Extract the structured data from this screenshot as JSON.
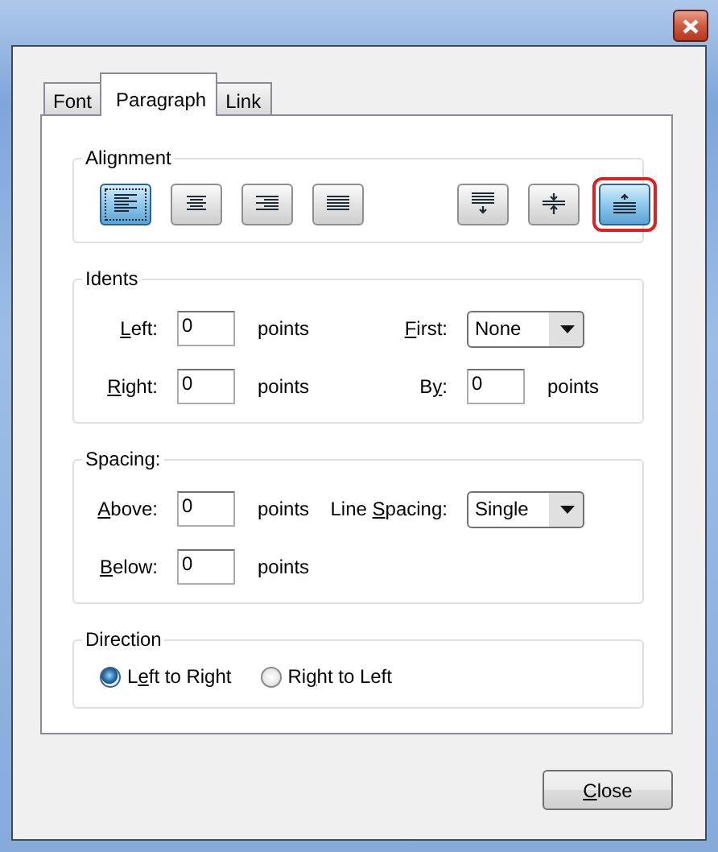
{
  "tabs": [
    {
      "label": "Font",
      "selected": false
    },
    {
      "label": "Paragraph",
      "selected": true
    },
    {
      "label": "Link",
      "selected": false
    }
  ],
  "alignment": {
    "title": "Alignment",
    "horizontal": [
      {
        "kind": "left",
        "selected": true,
        "focused": true,
        "outlined": false
      },
      {
        "kind": "center",
        "selected": false,
        "focused": false,
        "outlined": false
      },
      {
        "kind": "right",
        "selected": false,
        "focused": false,
        "outlined": false
      },
      {
        "kind": "justify",
        "selected": false,
        "focused": false,
        "outlined": false
      }
    ],
    "vertical": [
      {
        "kind": "top",
        "selected": false,
        "focused": false,
        "outlined": false
      },
      {
        "kind": "middle",
        "selected": false,
        "focused": false,
        "outlined": false
      },
      {
        "kind": "bottom",
        "selected": true,
        "focused": false,
        "outlined": true
      }
    ]
  },
  "indents": {
    "title": "Idents",
    "rows": [
      [
        {
          "kind": "number",
          "label": {
            "key": "L",
            "post": "eft:"
          },
          "value": "0",
          "unit": "points"
        },
        {
          "kind": "combo",
          "label": {
            "key": "F",
            "post": "irst:"
          },
          "value": "None"
        }
      ],
      [
        {
          "kind": "number",
          "label": {
            "key": "R",
            "post": "ight:"
          },
          "value": "0",
          "unit": "points"
        },
        {
          "kind": "number",
          "label": {
            "pre": "B",
            "key": "y",
            "post": ":"
          },
          "value": "0",
          "unit": "points"
        }
      ]
    ]
  },
  "spacing": {
    "title": "Spacing:",
    "rows": [
      [
        {
          "kind": "number",
          "label": {
            "key": "A",
            "post": "bove:"
          },
          "value": "0",
          "unit": "points"
        },
        {
          "kind": "combo",
          "label": {
            "pre": "Line ",
            "key": "S",
            "post": "pacing:"
          },
          "value": "Single"
        }
      ],
      [
        {
          "kind": "number",
          "label": {
            "key": "B",
            "post": "elow:"
          },
          "value": "0",
          "unit": "points"
        }
      ]
    ]
  },
  "direction": {
    "title": "Direction",
    "options": [
      {
        "label": {
          "pre": "L",
          "key": "e",
          "post": "ft to Right"
        },
        "selected": true
      },
      {
        "label": {
          "pre": "Ri",
          "key": "g",
          "post": "ht to Left"
        },
        "selected": false
      }
    ]
  },
  "close_button": {
    "label": {
      "key": "C",
      "post": "lose"
    }
  }
}
